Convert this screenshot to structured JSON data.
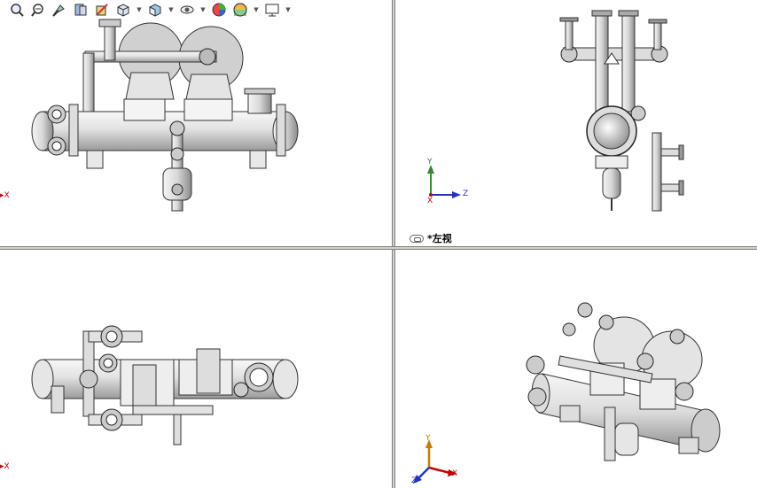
{
  "toolbar": {
    "buttons": [
      {
        "name": "zoom-to-fit-icon"
      },
      {
        "name": "zoom-to-area-icon"
      },
      {
        "name": "previous-view-icon"
      },
      {
        "name": "section-view-icon"
      },
      {
        "name": "dynamic-annotation-icon"
      },
      {
        "name": "view-orientation-icon",
        "dropdown": true
      },
      {
        "name": "display-style-icon",
        "dropdown": true
      },
      {
        "name": "hide-show-items-icon",
        "dropdown": true
      },
      {
        "name": "edit-appearance-icon"
      },
      {
        "name": "apply-scene-icon",
        "dropdown": true
      },
      {
        "name": "view-settings-icon",
        "dropdown": true
      }
    ]
  },
  "viewports": {
    "top_right": {
      "label": "*左视",
      "triad": {
        "y": "Y",
        "z": "Z",
        "x": "X"
      }
    },
    "top_left": {
      "triad_x": "X"
    },
    "bottom_left": {
      "triad_x": "X"
    },
    "bottom_right": {
      "triad": {
        "y": "Y",
        "x": "X",
        "z": "Z"
      }
    }
  },
  "colors": {
    "splitter": "#d4d0c8",
    "triad_x": "#cc0000",
    "triad_y": "#2e8b2e",
    "triad_z": "#2233cc"
  }
}
